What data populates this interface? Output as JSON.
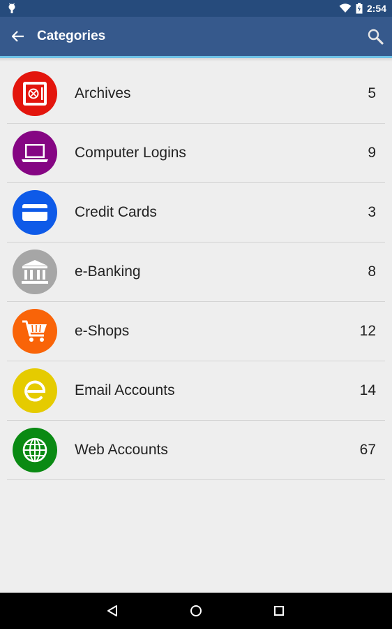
{
  "status_bar": {
    "time": "2:54"
  },
  "app_bar": {
    "title": "Categories"
  },
  "categories": [
    {
      "label": "Archives",
      "count": "5",
      "color": "#e3150d",
      "icon": "safe-icon"
    },
    {
      "label": "Computer Logins",
      "count": "9",
      "color": "#850583",
      "icon": "laptop-icon"
    },
    {
      "label": "Credit Cards",
      "count": "3",
      "color": "#0e5ae8",
      "icon": "credit-card-icon"
    },
    {
      "label": "e-Banking",
      "count": "8",
      "color": "#a6a6a6",
      "icon": "bank-icon"
    },
    {
      "label": "e-Shops",
      "count": "12",
      "color": "#f96408",
      "icon": "shopping-cart-icon"
    },
    {
      "label": "Email Accounts",
      "count": "14",
      "color": "#e5cb00",
      "icon": "email-at-icon"
    },
    {
      "label": "Web Accounts",
      "count": "67",
      "color": "#0a8a13",
      "icon": "globe-icon"
    }
  ],
  "colors": {
    "status_bar": "#264b7c",
    "app_bar": "#36598c",
    "accent": "#6ec2e6",
    "background": "#eeeeee"
  }
}
